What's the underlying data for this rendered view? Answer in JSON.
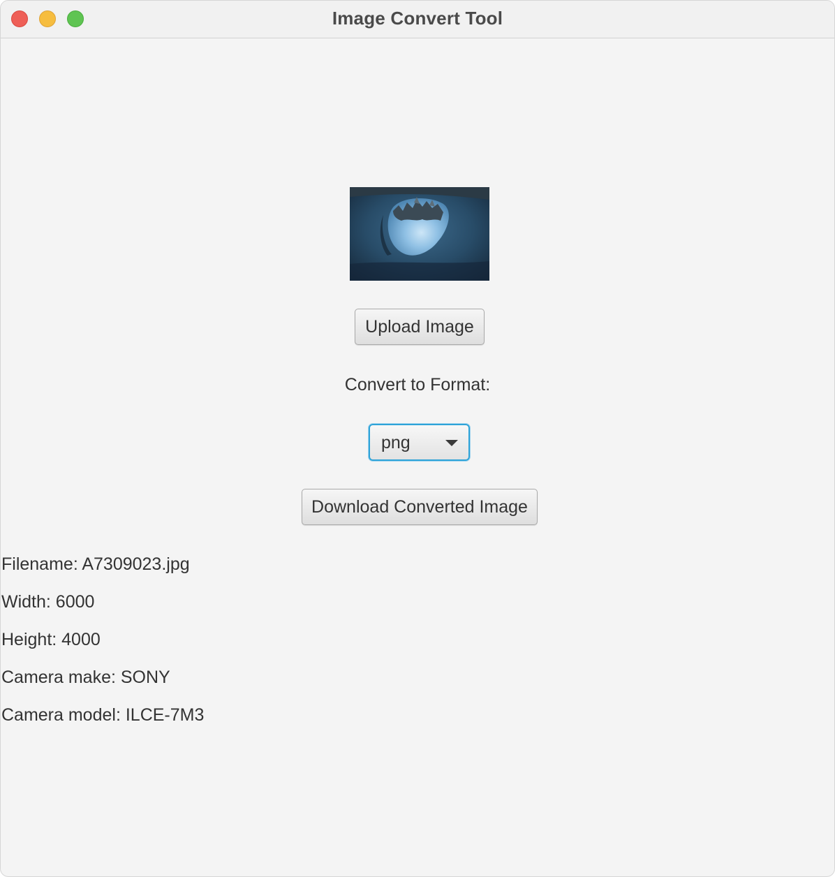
{
  "window": {
    "title": "Image Convert Tool"
  },
  "preview": {
    "description_icon": "image-preview"
  },
  "upload": {
    "label": "Upload Image"
  },
  "format": {
    "label": "Convert to Format:",
    "selected": "png",
    "accent": "#2ea3d8"
  },
  "download": {
    "label": "Download Converted Image"
  },
  "info": {
    "filename": "Filename: A7309023.jpg",
    "width": "Width: 6000",
    "height": "Height: 4000",
    "camera_make": "Camera make: SONY",
    "camera_model": "Camera model: ILCE-7M3"
  }
}
